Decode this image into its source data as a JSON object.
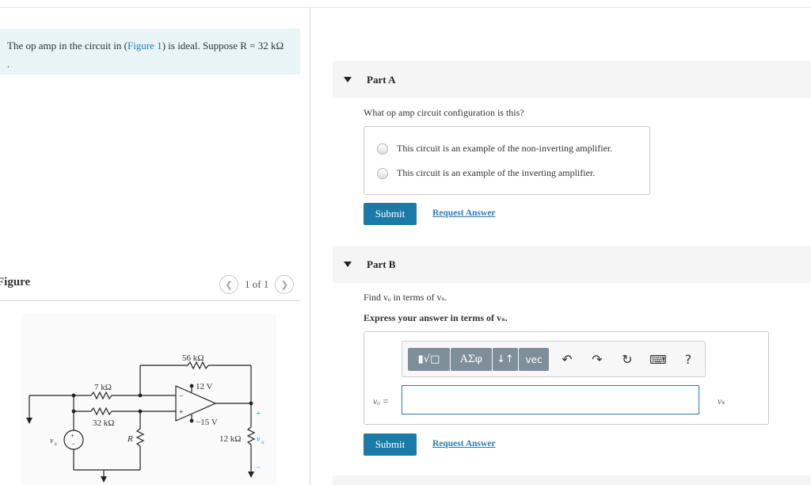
{
  "problem": {
    "text_before": "The op amp in the circuit in (",
    "figure_link": "Figure 1",
    "text_after": ") is ideal. Suppose R = 32  kΩ",
    "trailing": "."
  },
  "figure": {
    "title": "Figure",
    "pager": "1 of 1",
    "labels": {
      "r_feedback": "56 kΩ",
      "r_top": "7 kΩ",
      "r_bottom": "32 kΩ",
      "v_pos": "12 V",
      "v_neg": "−15 V",
      "r_var": "R",
      "r_load": "12 kΩ",
      "src": "v",
      "src_sub": "s",
      "out": "v",
      "out_sub": "o",
      "plus": "+",
      "minus": "−"
    }
  },
  "partA": {
    "title": "Part A",
    "question": "What op amp circuit configuration is this?",
    "options": [
      "This circuit is an example of the non-inverting amplifier.",
      "This circuit is an example of the inverting amplifier."
    ],
    "submit": "Submit",
    "request": "Request Answer"
  },
  "partB": {
    "title": "Part B",
    "question": "Find vₒ in terms of vₛ.",
    "instruction": "Express your answer in terms of vₛ.",
    "toolbar": {
      "templates": "▮√□",
      "greek": "AΣφ",
      "arrows": "↓↑",
      "vec": "vec",
      "help": "?"
    },
    "answer_label": "vₒ =",
    "answer_value": "",
    "unit": "vₛ",
    "submit": "Submit",
    "request": "Request Answer"
  }
}
